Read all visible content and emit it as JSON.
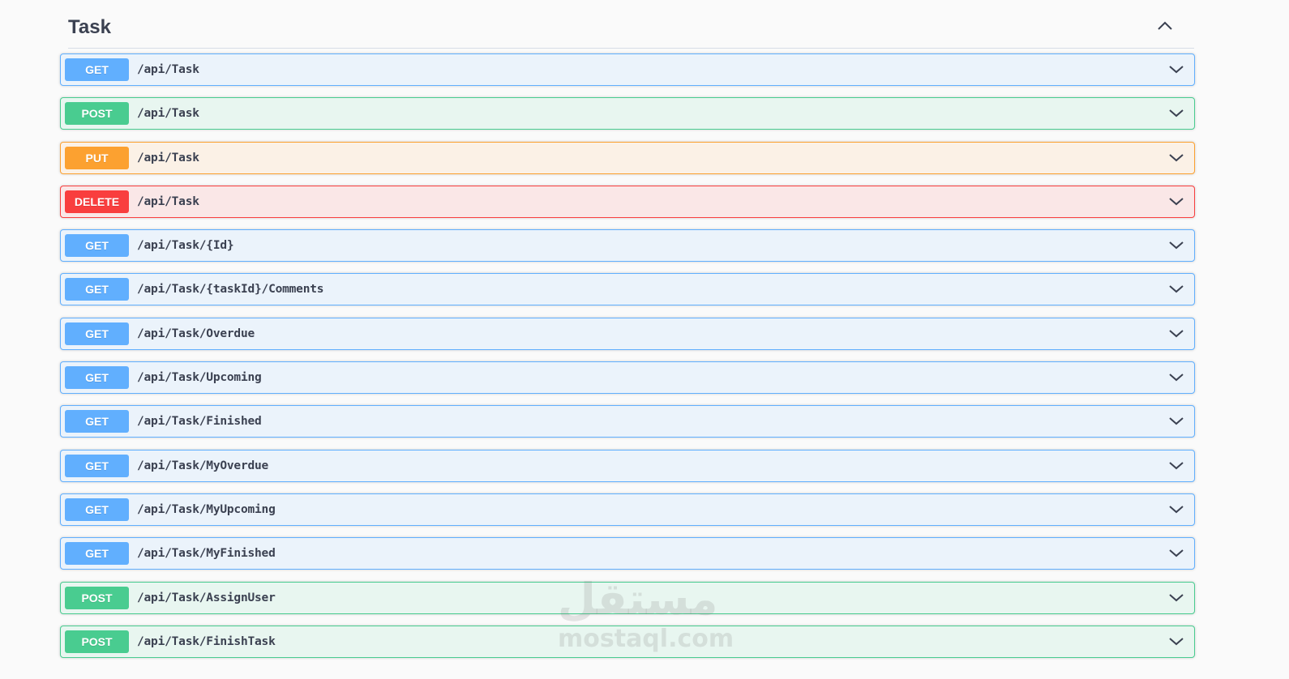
{
  "tag": {
    "title": "Task"
  },
  "operations": [
    {
      "method": "GET",
      "path": "/api/Task"
    },
    {
      "method": "POST",
      "path": "/api/Task"
    },
    {
      "method": "PUT",
      "path": "/api/Task"
    },
    {
      "method": "DELETE",
      "path": "/api/Task"
    },
    {
      "method": "GET",
      "path": "/api/Task/{Id}"
    },
    {
      "method": "GET",
      "path": "/api/Task/{taskId}/Comments"
    },
    {
      "method": "GET",
      "path": "/api/Task/Overdue"
    },
    {
      "method": "GET",
      "path": "/api/Task/Upcoming"
    },
    {
      "method": "GET",
      "path": "/api/Task/Finished"
    },
    {
      "method": "GET",
      "path": "/api/Task/MyOverdue"
    },
    {
      "method": "GET",
      "path": "/api/Task/MyUpcoming"
    },
    {
      "method": "GET",
      "path": "/api/Task/MyFinished"
    },
    {
      "method": "POST",
      "path": "/api/Task/AssignUser"
    },
    {
      "method": "POST",
      "path": "/api/Task/FinishTask"
    }
  ],
  "watermark": {
    "arabic": "مستقل",
    "latin": "mostaql.com"
  },
  "colors": {
    "get": "#61affe",
    "post": "#49cc90",
    "put": "#fca130",
    "delete": "#f93e3e",
    "text": "#3b4151"
  },
  "icons": {
    "collapse": "chevron-up-icon",
    "expand": "chevron-down-icon"
  }
}
